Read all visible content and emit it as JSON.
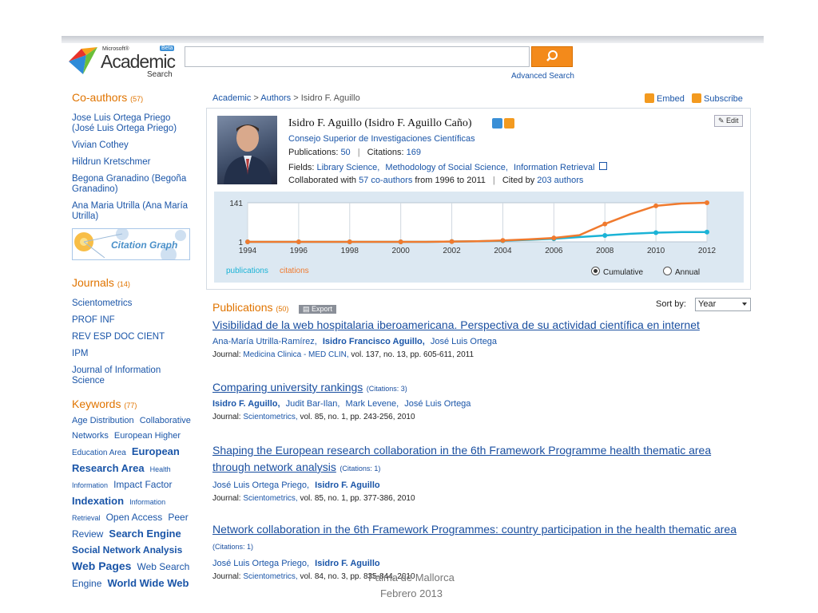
{
  "app": {
    "logo_ms": "Microsoft®",
    "logo_name": "Academic",
    "logo_sub": "Search",
    "logo_badge": "Beta"
  },
  "search": {
    "placeholder": "",
    "value": "",
    "advanced": "Advanced Search"
  },
  "breadcrumb": {
    "level1": "Academic",
    "level2": "Authors",
    "current": "Isidro F. Aguillo"
  },
  "toolbar": {
    "embed": "Embed",
    "subscribe": "Subscribe"
  },
  "sidebar": {
    "coauthors": {
      "title": "Co-authors",
      "count": "(57)",
      "items": [
        "Jose Luis Ortega Priego (José Luis Ortega Priego)",
        "Vivian Cothey",
        "Hildrun Kretschmer",
        "Begona Granadino (Begoña Granadino)",
        "Ana Maria Utrilla (Ana María Utrilla)"
      ]
    },
    "citation_graph": "Citation Graph",
    "journals": {
      "title": "Journals",
      "count": "(14)",
      "items": [
        "Scientometrics",
        "PROF INF",
        "REV ESP DOC CIENT",
        "IPM",
        "Journal of Information Science"
      ]
    },
    "keywords": {
      "title": "Keywords",
      "count": "(77)",
      "items": [
        {
          "t": "Age Distribution",
          "s": 11
        },
        {
          "t": "Collaborative",
          "s": 11
        },
        {
          "t": "Networks",
          "s": 11
        },
        {
          "t": "European Higher",
          "s": 11
        },
        {
          "t": "Education Area",
          "s": 10
        },
        {
          "t": "European",
          "s": 13,
          "b": true
        },
        {
          "t": "Research Area",
          "s": 13,
          "b": true
        },
        {
          "t": "Health",
          "s": 9
        },
        {
          "t": "Information",
          "s": 9
        },
        {
          "t": "Impact Factor",
          "s": 12
        },
        {
          "t": "Indexation",
          "s": 13,
          "b": true
        },
        {
          "t": "Information",
          "s": 9
        },
        {
          "t": "Retrieval",
          "s": 9
        },
        {
          "t": "Open Access",
          "s": 12
        },
        {
          "t": "Peer",
          "s": 12
        },
        {
          "t": "Review",
          "s": 12
        },
        {
          "t": "Search Engine",
          "s": 13,
          "b": true
        },
        {
          "t": "Social Network Analysis",
          "s": 12,
          "b": true
        },
        {
          "t": "Web Pages",
          "s": 14,
          "b": true
        },
        {
          "t": "Web Search",
          "s": 12
        },
        {
          "t": "Engine",
          "s": 12
        },
        {
          "t": "World Wide Web",
          "s": 13,
          "b": true
        }
      ]
    }
  },
  "profile": {
    "name": "Isidro F. Aguillo (Isidro F. Aguillo Caño)",
    "affiliation": "Consejo Superior de Investigaciones Científicas",
    "publications_label": "Publications:",
    "publications": "50",
    "citations_label": "Citations:",
    "citations": "169",
    "fields_label": "Fields:",
    "fields": [
      "Library Science,",
      "Methodology of Social Science,",
      "Information Retrieval"
    ],
    "collab_prefix": "Collaborated with",
    "collab_link": "57 co-authors",
    "collab_mid": "from 1996 to 2011",
    "cited_prefix": "Cited by",
    "cited_link": "203 authors",
    "edit": "Edit"
  },
  "chart_data": {
    "type": "line",
    "x": [
      1994,
      1995,
      1996,
      1997,
      1998,
      1999,
      2000,
      2001,
      2002,
      2003,
      2004,
      2005,
      2006,
      2007,
      2008,
      2009,
      2010,
      2011,
      2012
    ],
    "series": [
      {
        "name": "publications",
        "color": "#1bb3d6",
        "values": [
          1,
          1,
          1,
          1,
          1,
          1,
          1,
          1,
          2,
          3,
          5,
          8,
          12,
          18,
          24,
          30,
          34,
          36,
          36
        ]
      },
      {
        "name": "citations",
        "color": "#f07a2e",
        "values": [
          1,
          1,
          1,
          1,
          1,
          1,
          1,
          1,
          2,
          3,
          6,
          10,
          15,
          25,
          65,
          100,
          130,
          138,
          141
        ]
      }
    ],
    "ylim": [
      1,
      141
    ],
    "ytick_labels": [
      "141",
      "1"
    ],
    "xtick_labels": [
      "1994",
      "1996",
      "1998",
      "2000",
      "2002",
      "2004",
      "2006",
      "2008",
      "2010",
      "2012"
    ],
    "grid": true,
    "legend_position": "bottom-left"
  },
  "chart_controls": {
    "cumulative": "Cumulative",
    "annual": "Annual",
    "selected": "cumulative"
  },
  "publications": {
    "title": "Publications",
    "count": "(50)",
    "export": "Export",
    "sort_label": "Sort by:",
    "sort_value": "Year",
    "items": [
      {
        "title": "Visibilidad de la web hospitalaria iberoamericana. Perspectiva de su actividad científica en internet",
        "citations": "",
        "authors": [
          {
            "n": "Ana-María Utrilla-Ramírez,",
            "b": false
          },
          {
            "n": "Isidro Francisco Aguillo,",
            "b": true
          },
          {
            "n": "José Luis Ortega",
            "b": false
          }
        ],
        "journal_label": "Journal:",
        "journal": "Medicina Clinica - MED CLIN,",
        "details": "vol. 137, no. 13, pp. 605-611, 2011"
      },
      {
        "title": "Comparing university rankings",
        "citations": "(Citations: 3)",
        "authors": [
          {
            "n": "Isidro F. Aguillo,",
            "b": true
          },
          {
            "n": "Judit Bar-Ilan,",
            "b": false
          },
          {
            "n": "Mark Levene,",
            "b": false
          },
          {
            "n": "José Luis Ortega",
            "b": false
          }
        ],
        "journal_label": "Journal:",
        "journal": "Scientometrics,",
        "details": "vol. 85, no. 1, pp. 243-256, 2010"
      },
      {
        "title": "Shaping the European research collaboration in the 6th Framework Programme health thematic area through network analysis",
        "citations": "(Citations: 1)",
        "authors": [
          {
            "n": "José Luis Ortega Priego,",
            "b": false
          },
          {
            "n": "Isidro F. Aguillo",
            "b": true
          }
        ],
        "journal_label": "Journal:",
        "journal": "Scientometrics,",
        "details": "vol. 85, no. 1, pp. 377-386, 2010"
      },
      {
        "title": "Network collaboration in the 6th Framework Programmes: country participation in the health thematic area",
        "citations": "(Citations: 1)",
        "authors": [
          {
            "n": "José Luis Ortega Priego,",
            "b": false
          },
          {
            "n": "Isidro F. Aguillo",
            "b": true
          }
        ],
        "journal_label": "Journal:",
        "journal": "Scientometrics,",
        "details": "vol. 84, no. 3, pp. 835-844, 2010"
      }
    ]
  },
  "footer": {
    "line1": "Palma de Mallorca",
    "line2": "Febrero 2013"
  },
  "colors": {
    "accent": "#e07400",
    "link": "#1a55a8",
    "search_button": "#f38a1b",
    "chart_bg": "#dce8f2"
  }
}
